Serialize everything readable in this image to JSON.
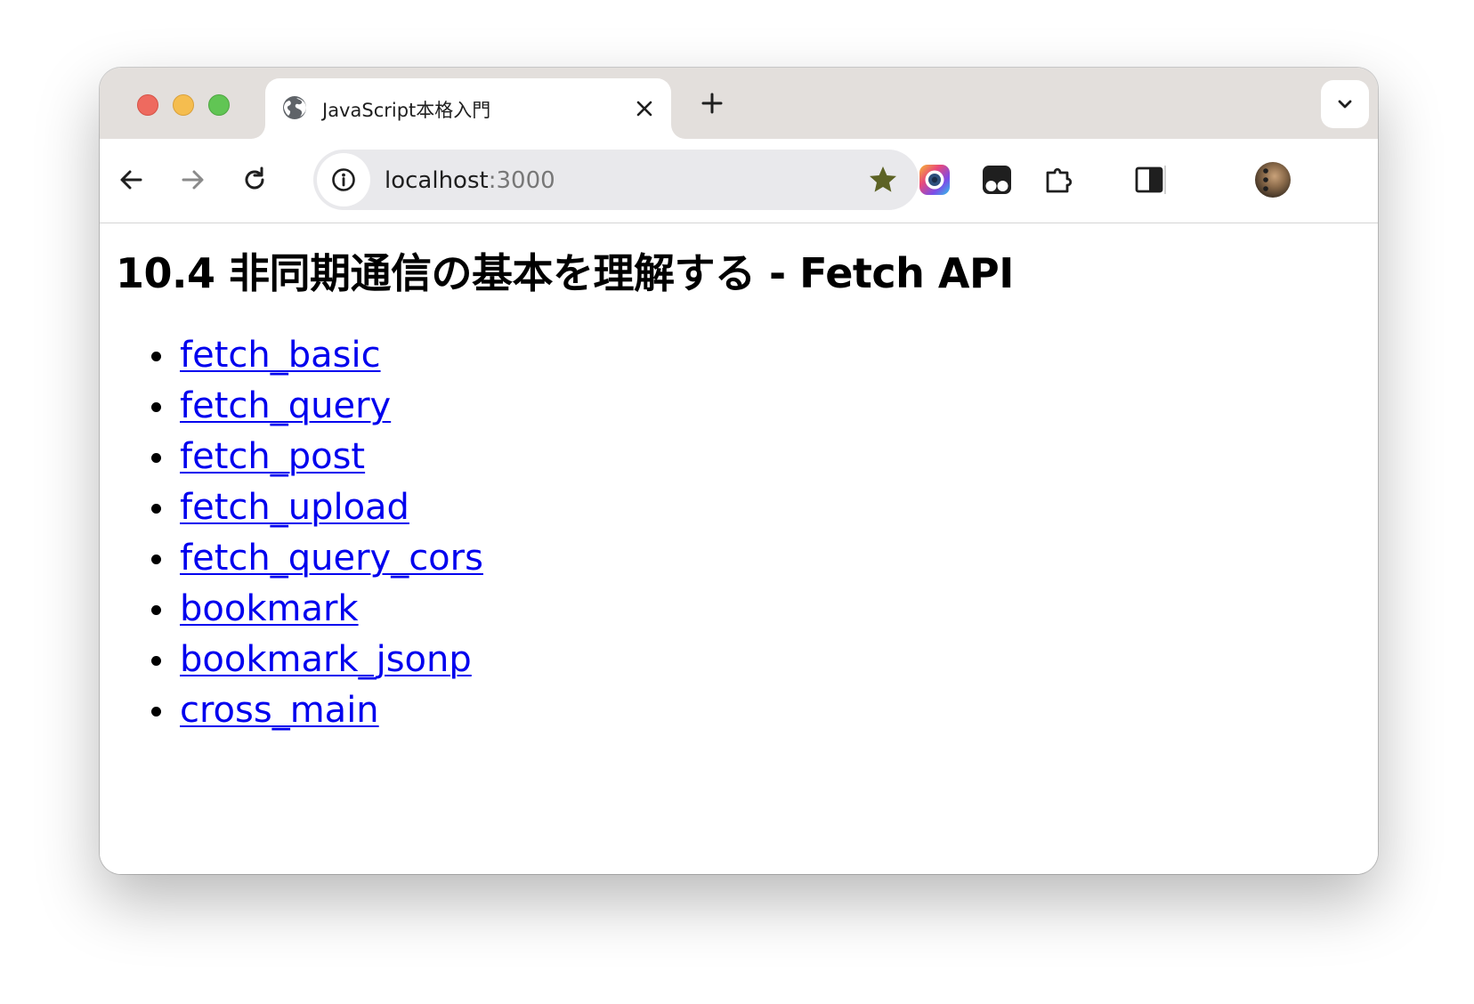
{
  "browser": {
    "tab": {
      "title": "JavaScript本格入門",
      "favicon": "globe-icon"
    },
    "address_bar": {
      "host": "localhost",
      "port": ":3000"
    },
    "colors": {
      "tab_strip": "#e3dfdc",
      "omnibox": "#e9e9ec",
      "bookmark_star": "#5d6325",
      "link": "#0000ee"
    },
    "toolbar_icons": [
      "back-arrow-icon",
      "forward-arrow-icon",
      "reload-icon",
      "site-info-icon",
      "bookmark-star-icon",
      "color-picker-extension-icon",
      "tampermonkey-extension-icon",
      "extensions-puzzle-icon",
      "side-panel-icon",
      "profile-avatar",
      "kebab-menu-icon"
    ]
  },
  "page": {
    "heading": "10.4 非同期通信の基本を理解する - Fetch API",
    "links": [
      {
        "label": "fetch_basic"
      },
      {
        "label": "fetch_query"
      },
      {
        "label": "fetch_post"
      },
      {
        "label": "fetch_upload"
      },
      {
        "label": "fetch_query_cors"
      },
      {
        "label": "bookmark"
      },
      {
        "label": "bookmark_jsonp"
      },
      {
        "label": "cross_main"
      }
    ]
  }
}
